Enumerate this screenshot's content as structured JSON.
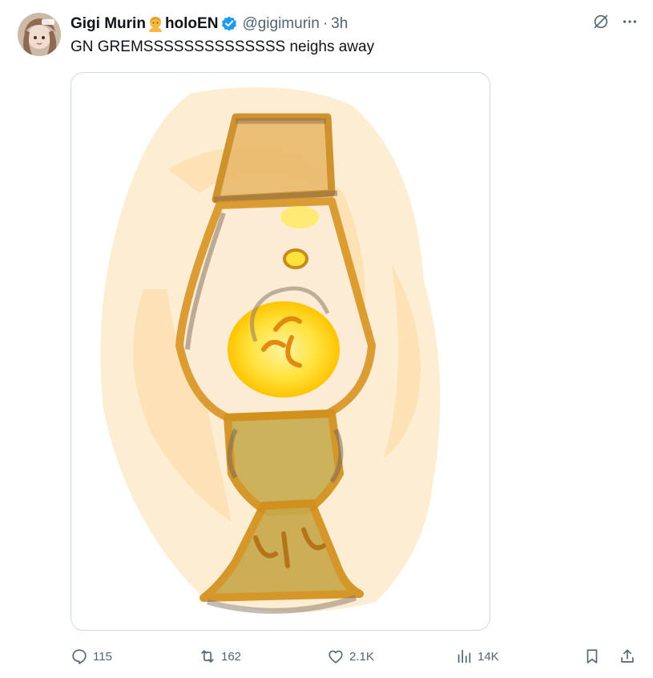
{
  "tweet": {
    "display_name": "Gigi Murin",
    "org_label": "holoEN",
    "handle": "@gigimurin",
    "separator": "·",
    "time": "3h",
    "text": "GN GREMSSSSSSSSSSSSSS neighs away",
    "emoji": "person-emoji",
    "verified": true
  },
  "media": {
    "alt": "Hand-drawn sketch of a yellow lava lamp"
  },
  "actions": {
    "replies": "115",
    "reposts": "162",
    "likes": "2.1K",
    "views": "14K"
  },
  "colors": {
    "text": "#0f1419",
    "secondary": "#536471",
    "verified": "#1d9bf0",
    "border": "#cfd9de"
  }
}
